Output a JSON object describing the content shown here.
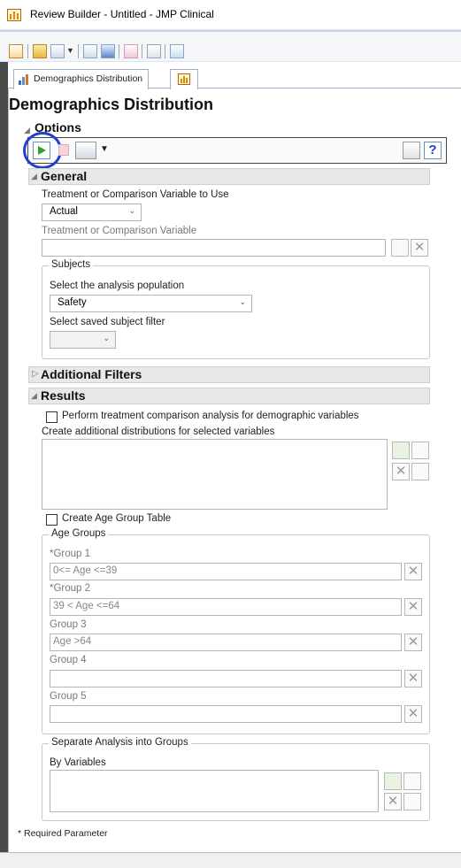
{
  "window": {
    "title": "Review Builder - Untitled - JMP Clinical"
  },
  "tab": {
    "label": "Demographics Distribution"
  },
  "page_title": "Demographics Distribution",
  "options": {
    "title": "Options"
  },
  "general": {
    "title": "General",
    "treatment_to_use_label": "Treatment or Comparison Variable to Use",
    "treatment_to_use_value": "Actual",
    "treatment_var_label": "Treatment or Comparison Variable",
    "treatment_var_value": ""
  },
  "subjects": {
    "legend": "Subjects",
    "population_label": "Select the analysis population",
    "population_value": "Safety",
    "filter_label": "Select saved subject filter",
    "filter_value": ""
  },
  "additional_filters": {
    "title": "Additional Filters"
  },
  "results": {
    "title": "Results",
    "perform_comparison_label": "Perform treatment comparison analysis for demographic variables",
    "additional_distributions_label": "Create additional distributions for selected variables",
    "create_age_group_label": "Create Age Group Table"
  },
  "age_groups": {
    "legend": "Age Groups",
    "groups": [
      {
        "label": "*Group 1",
        "value": "0<= Age <=39"
      },
      {
        "label": "*Group 2",
        "value": "39 < Age <=64"
      },
      {
        "label": "Group 3",
        "value": "Age >64"
      },
      {
        "label": "Group 4",
        "value": ""
      },
      {
        "label": "Group 5",
        "value": ""
      }
    ]
  },
  "separate": {
    "legend": "Separate Analysis into Groups",
    "by_variables_label": "By Variables"
  },
  "footer": {
    "required_note": "* Required Parameter"
  },
  "colors": {
    "run_green": "#2aa12a",
    "highlight_circle": "#1f3fd6",
    "section_bg": "#e8e8e8"
  }
}
